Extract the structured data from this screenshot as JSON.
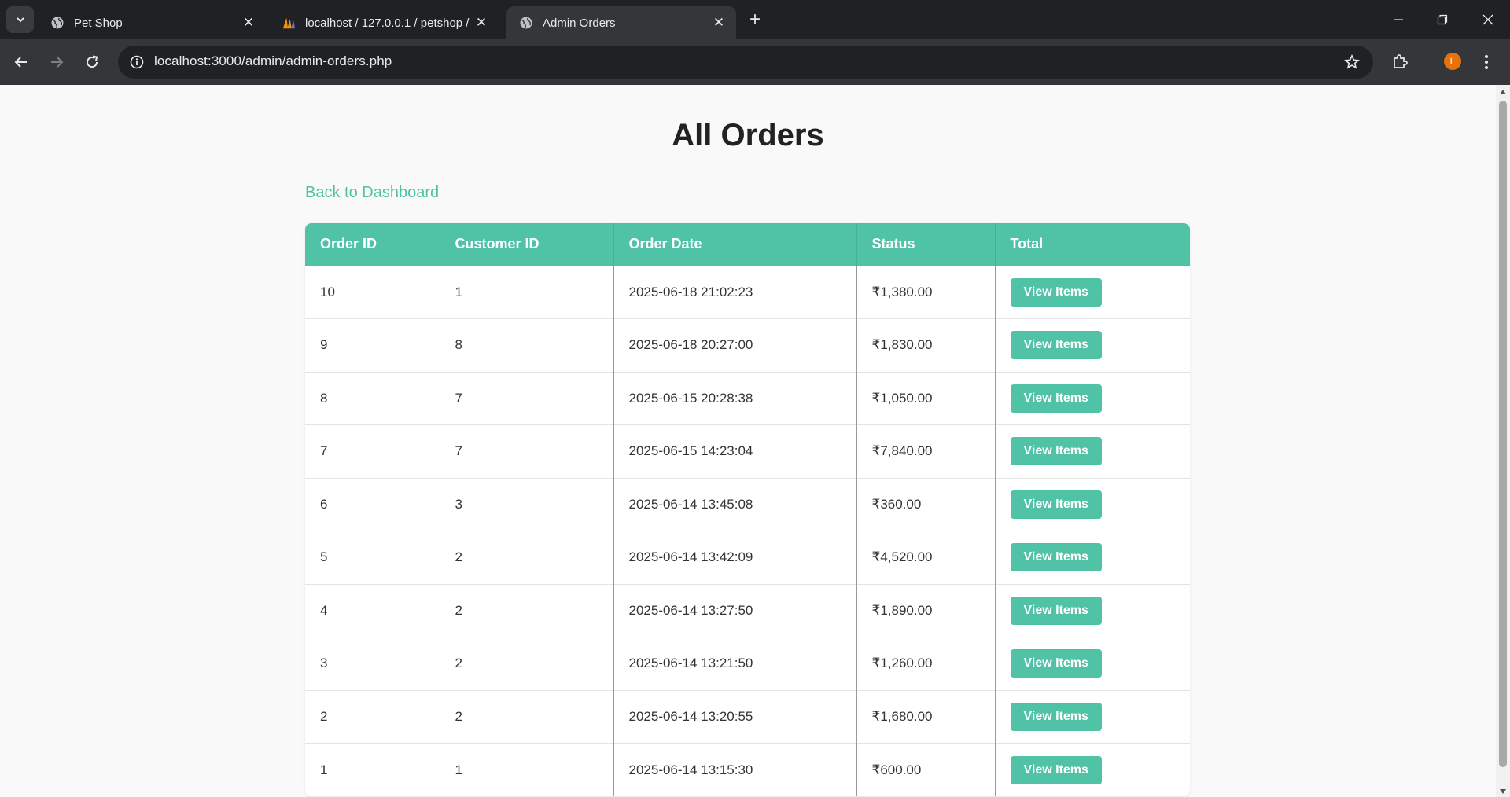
{
  "browser": {
    "tabs": [
      {
        "title": "Pet Shop",
        "icon": "globe-icon",
        "active": false
      },
      {
        "title": "localhost / 127.0.0.1 / petshop /",
        "icon": "phpmyadmin-icon",
        "active": false
      },
      {
        "title": "Admin Orders",
        "icon": "globe-icon",
        "active": true
      }
    ],
    "url": "localhost:3000/admin/admin-orders.php",
    "profile_initial": "L",
    "profile_color": "#e8710a"
  },
  "page": {
    "title": "All Orders",
    "back_link": "Back to Dashboard",
    "accent_color": "#50c2a6"
  },
  "table": {
    "headers": [
      "Order ID",
      "Customer ID",
      "Order Date",
      "Status",
      "Total"
    ],
    "button_label": "View Items",
    "rows": [
      {
        "order_id": "10",
        "customer_id": "1",
        "date": "2025-06-18 21:02:23",
        "amount": "₹1,380.00"
      },
      {
        "order_id": "9",
        "customer_id": "8",
        "date": "2025-06-18 20:27:00",
        "amount": "₹1,830.00"
      },
      {
        "order_id": "8",
        "customer_id": "7",
        "date": "2025-06-15 20:28:38",
        "amount": "₹1,050.00"
      },
      {
        "order_id": "7",
        "customer_id": "7",
        "date": "2025-06-15 14:23:04",
        "amount": "₹7,840.00"
      },
      {
        "order_id": "6",
        "customer_id": "3",
        "date": "2025-06-14 13:45:08",
        "amount": "₹360.00"
      },
      {
        "order_id": "5",
        "customer_id": "2",
        "date": "2025-06-14 13:42:09",
        "amount": "₹4,520.00"
      },
      {
        "order_id": "4",
        "customer_id": "2",
        "date": "2025-06-14 13:27:50",
        "amount": "₹1,890.00"
      },
      {
        "order_id": "3",
        "customer_id": "2",
        "date": "2025-06-14 13:21:50",
        "amount": "₹1,260.00"
      },
      {
        "order_id": "2",
        "customer_id": "2",
        "date": "2025-06-14 13:20:55",
        "amount": "₹1,680.00"
      },
      {
        "order_id": "1",
        "customer_id": "1",
        "date": "2025-06-14 13:15:30",
        "amount": "₹600.00"
      }
    ]
  }
}
